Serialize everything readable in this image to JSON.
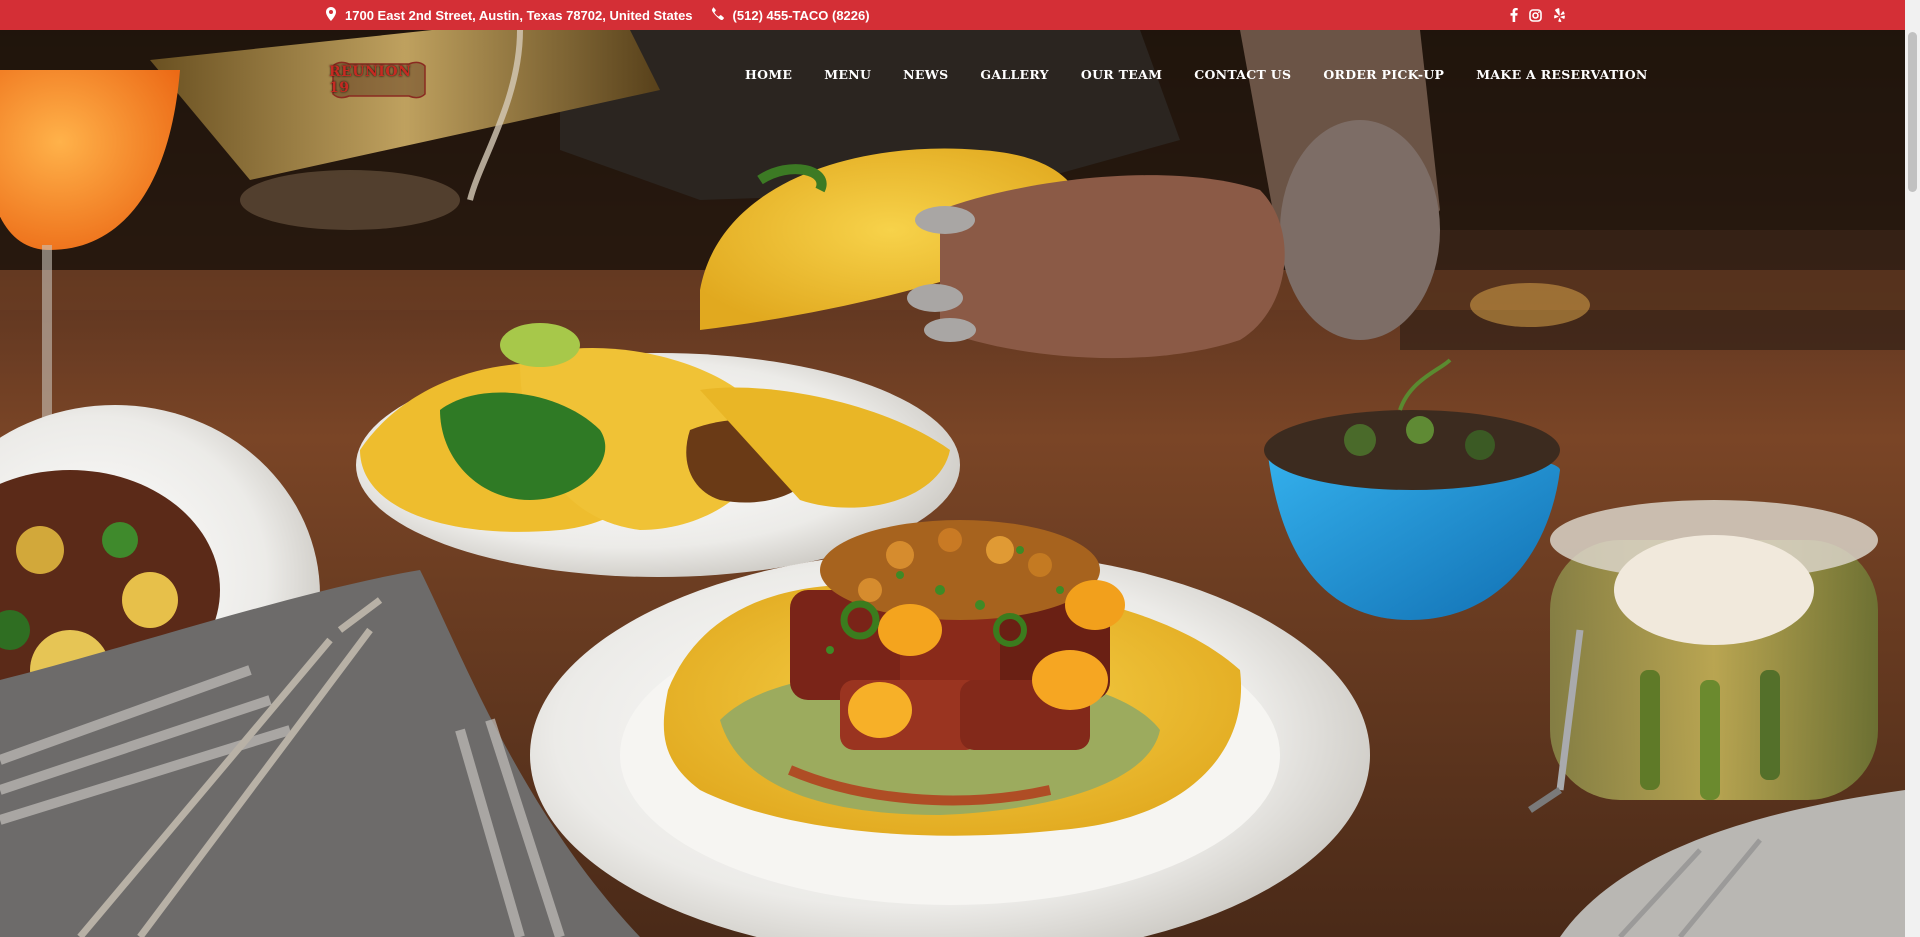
{
  "topbar": {
    "address": "1700 East 2nd Street, Austin, Texas 78702, United States",
    "phone": "(512) 455-TACO (8226)",
    "address_icon": "map-marker-icon",
    "phone_icon": "phone-icon",
    "social": [
      "facebook-icon",
      "instagram-icon",
      "yelp-icon"
    ],
    "bg_color": "#d42f36"
  },
  "logo": {
    "text": "REUNION 19"
  },
  "nav": {
    "items": [
      "HOME",
      "MENU",
      "NEWS",
      "GALLERY",
      "OUR TEAM",
      "CONTACT US",
      "ORDER PICK-UP",
      "MAKE A RESERVATION"
    ]
  }
}
